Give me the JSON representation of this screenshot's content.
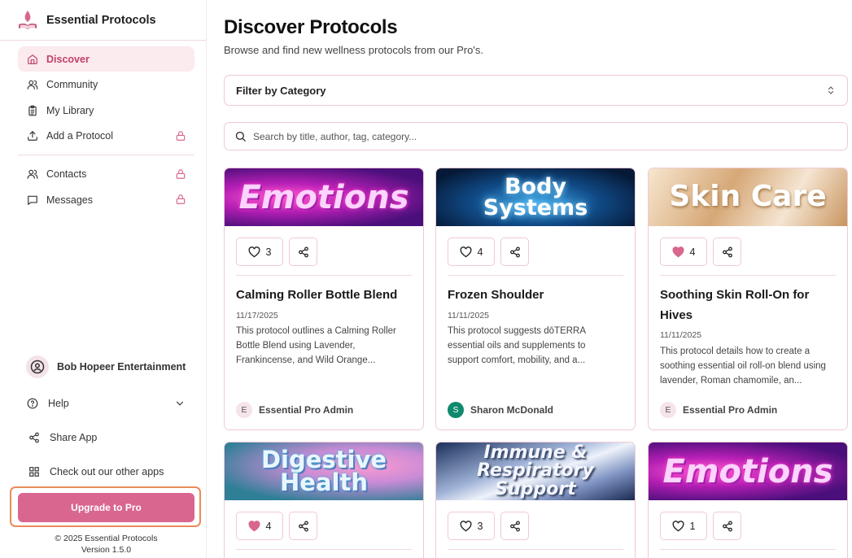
{
  "brand": {
    "title": "Essential Protocols"
  },
  "nav": {
    "primary": [
      {
        "label": "Discover",
        "icon": "home-icon",
        "active": true,
        "locked": false
      },
      {
        "label": "Community",
        "icon": "users-icon",
        "active": false,
        "locked": false
      },
      {
        "label": "My Library",
        "icon": "clipboard-icon",
        "active": false,
        "locked": false
      },
      {
        "label": "Add a Protocol",
        "icon": "upload-icon",
        "active": false,
        "locked": true
      }
    ],
    "secondary": [
      {
        "label": "Contacts",
        "icon": "users-icon",
        "locked": true
      },
      {
        "label": "Messages",
        "icon": "message-icon",
        "locked": true
      }
    ]
  },
  "user": {
    "name": "Bob Hopeer Entertainment"
  },
  "sidebar_links": {
    "help": "Help",
    "share": "Share App",
    "apps": "Check out our other apps"
  },
  "upgrade": {
    "label": "Upgrade to Pro"
  },
  "footer": {
    "copyright": "© 2025 Essential Protocols",
    "version": "Version 1.5.0"
  },
  "page": {
    "title": "Discover Protocols",
    "subtitle": "Browse and find new wellness protocols from our Pro's.",
    "filter_label": "Filter by Category",
    "search_placeholder": "Search by title, author, tag, category..."
  },
  "colors": {
    "accent": "#d9668f",
    "accent_light": "#fbeaee",
    "border": "#f0c9d4",
    "liked_heart": "#d9668f",
    "highlight_outline": "#ea8a5b"
  },
  "cards": [
    {
      "banner": "Emotions",
      "likes": "3",
      "liked": false,
      "title": "Calming Roller Bottle Blend",
      "date": "11/17/2025",
      "description": "This protocol outlines a Calming Roller Bottle Blend using Lavender, Frankincense, and Wild Orange...",
      "author": "Essential Pro Admin",
      "author_initial": "E"
    },
    {
      "banner": "Body Systems",
      "likes": "4",
      "liked": false,
      "title": "Frozen Shoulder",
      "date": "11/11/2025",
      "description": "This protocol suggests dōTERRA essential oils and supplements to support comfort, mobility, and a...",
      "author": "Sharon McDonald",
      "author_initial": "S"
    },
    {
      "banner": "Skin Care",
      "likes": "4",
      "liked": true,
      "title": "Soothing Skin Roll-On for Hives",
      "date": "11/11/2025",
      "description": "This protocol details how to create a soothing essential oil roll-on blend using lavender, Roman chamomile, an...",
      "author": "Essential Pro Admin",
      "author_initial": "E"
    },
    {
      "banner": "Digestive Health",
      "likes": "4",
      "liked": true
    },
    {
      "banner": "Immune & Respiratory Support",
      "likes": "3",
      "liked": false
    },
    {
      "banner": "Emotions",
      "likes": "1",
      "liked": false
    }
  ]
}
